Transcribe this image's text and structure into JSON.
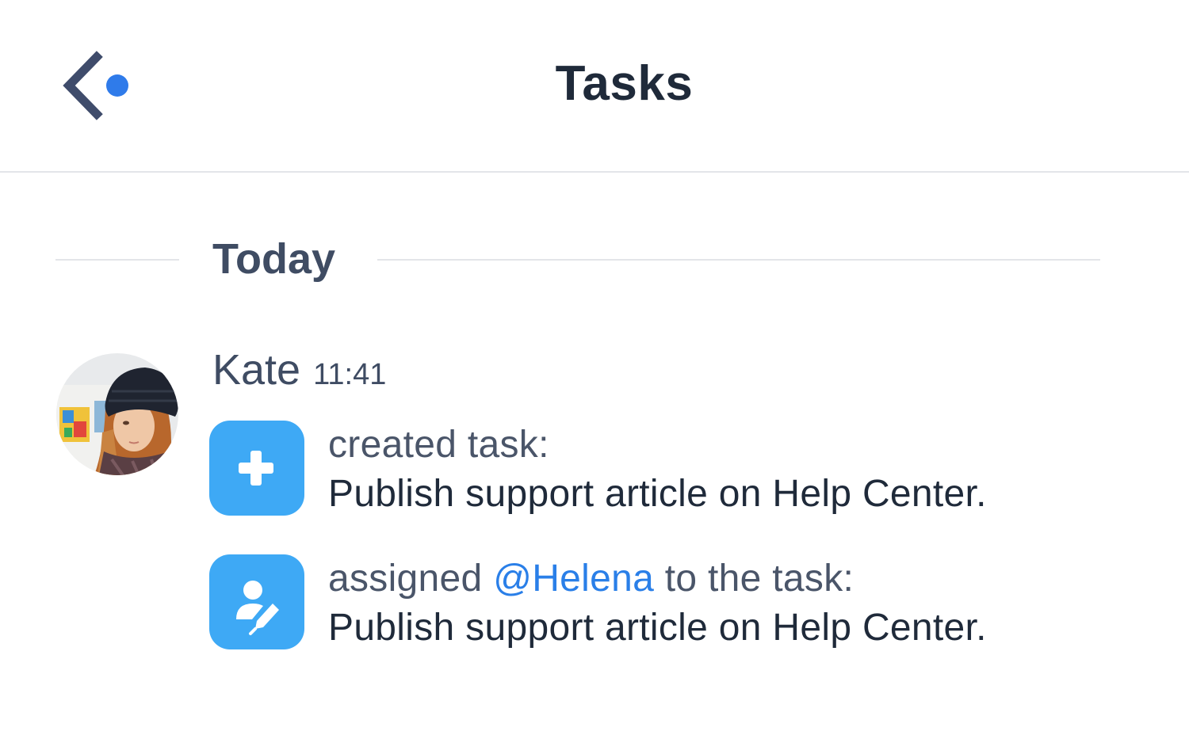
{
  "header": {
    "title": "Tasks",
    "back_indicator_color": "#2f7bea"
  },
  "timeline": {
    "day_label": "Today"
  },
  "message_group": {
    "author": "Kate",
    "time": "11:41",
    "events": [
      {
        "icon": "add-task-icon",
        "action": "created task:",
        "task": "Publish support article on Help Center."
      },
      {
        "icon": "assign-user-icon",
        "action_prefix": "assigned",
        "mention": "@Helena",
        "action_suffix": "to the task:",
        "task": "Publish support article on Help Center."
      }
    ]
  },
  "colors": {
    "icon_bg": "#3ea9f5",
    "mention": "#2a7fe8",
    "title": "#1f2a3a",
    "secondary_text": "#3f4c63"
  }
}
